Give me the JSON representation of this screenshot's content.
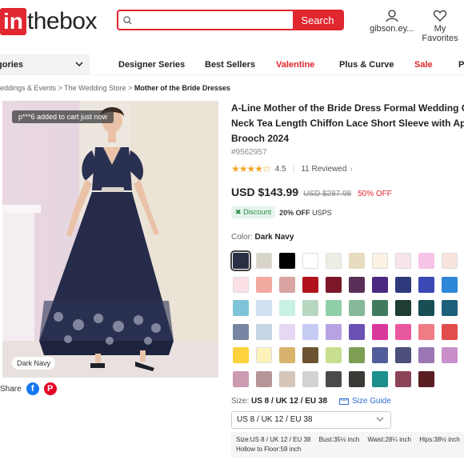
{
  "header": {
    "logo_in": "in",
    "logo_rest": "thebox",
    "search_placeholder": "",
    "search_button": "Search",
    "account_label": "gibson.ey...",
    "favorites_label": "My Favorites"
  },
  "nav": {
    "category_label": "gories",
    "links": [
      "Designer Series",
      "Best Sellers",
      "Valentine",
      "Plus & Curve",
      "Sale",
      "P"
    ]
  },
  "breadcrumb": {
    "items": [
      "eddings & Events",
      "The Wedding Store"
    ],
    "current": "Mother of the Bride Dresses",
    "separator": ">"
  },
  "image": {
    "toast": "p***6 added to cart just now",
    "color_tag": "Dark Navy"
  },
  "share": {
    "label": "Share"
  },
  "product": {
    "title_lines": [
      "A-Line Mother of the Bride Dress Formal Wedding Gues",
      "Neck Tea Length Chiffon Lace Short Sleeve with Appliqu",
      "Brooch 2024"
    ],
    "sku": "#9562957",
    "rating": "4.5",
    "reviews": "11 Reviewed",
    "price": "USD $143.99",
    "original_price": "USD $287.98",
    "discount_pct": "50% OFF",
    "discount_badge": "Discount",
    "discount_text_bold": "20% OFF",
    "discount_text": "USPS"
  },
  "color": {
    "label": "Color:",
    "selected": "Dark Navy",
    "swatches": [
      "#2b2f45",
      "#d9d4c8",
      "#000000",
      "#ffffff",
      "#eeeee4",
      "#e8dcc0",
      "#fbf1e4",
      "#f8e4ea",
      "#f7c3e6",
      "#f9e3dd",
      "#fbe1e6",
      "#f2a9a0",
      "#d9a3a2",
      "#b1121b",
      "#7c1729",
      "#5b2e58",
      "#4b2a82",
      "#2d3b7c",
      "#3b48b6",
      "#2e87d8",
      "#7ec4d9",
      "#cfe0f2",
      "#c9f1e6",
      "#b7d7c0",
      "#8fcfaa",
      "#86b89a",
      "#3f7a5c",
      "#1f3d31",
      "#174f55",
      "#1e5f79",
      "#7785a3",
      "#c6d4e6",
      "#e6d7f5",
      "#c6cbf3",
      "#b7a3e4",
      "#6b50b5",
      "#d8379c",
      "#e8589f",
      "#f07d86",
      "#e24d4e",
      "#fdd23e",
      "#fcf3b8",
      "#d8b36d",
      "#6b5230",
      "#c8df8f",
      "#7e9e54",
      "#525d9b",
      "#4c4f7a",
      "#9b78b5",
      "#c88fcb",
      "#cc9ab1",
      "#b59798",
      "#d6c6ba",
      "#d3d3d3",
      "#4a4a4a",
      "#3b3a36",
      "#1c8f8f",
      "#8c4358",
      "#5a1d22"
    ],
    "selected_index": 0
  },
  "size": {
    "label": "Size:",
    "selected": "US 8 / UK 12 / EU 38",
    "guide": "Size Guide",
    "dropdown_value": "US 8 / UK 12 / EU 38",
    "details": [
      "Size:US 8 / UK 12 / EU 38",
      "Bust:35½ inch",
      "Waist:28¼ inch",
      "Hips:38½ inch"
    ],
    "details_line2": "Hollow to Floor:59 inch"
  }
}
